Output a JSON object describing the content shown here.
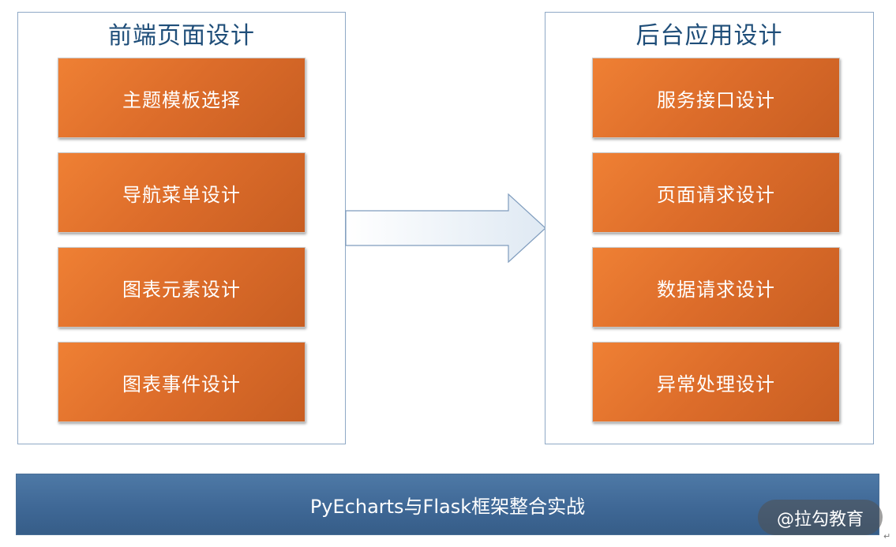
{
  "left_panel": {
    "title": "前端页面设计",
    "items": [
      "主题模板选择",
      "导航菜单设计",
      "图表元素设计",
      "图表事件设计"
    ]
  },
  "right_panel": {
    "title": "后台应用设计",
    "items": [
      "服务接口设计",
      "页面请求设计",
      "数据请求设计",
      "异常处理设计"
    ]
  },
  "bottom_bar": {
    "label": "PyEcharts与Flask框架整合实战"
  },
  "watermark": {
    "text": "@拉勾教育"
  },
  "paragraph_mark": "↵",
  "colors": {
    "box_orange": "#dc6c2a",
    "bar_blue": "#3f6896",
    "title_blue": "#1f4e79",
    "panel_border": "#8fa9c6"
  }
}
